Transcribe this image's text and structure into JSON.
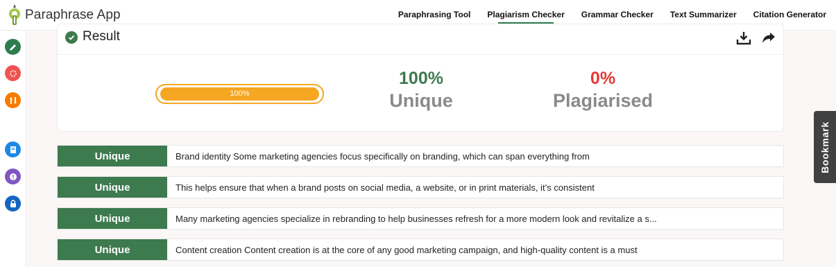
{
  "app": {
    "name": "Paraphrase App"
  },
  "nav": {
    "items": [
      {
        "label": "Paraphrasing Tool"
      },
      {
        "label": "Plagiarism Checker",
        "active": true
      },
      {
        "label": "Grammar Checker"
      },
      {
        "label": "Text Summarizer"
      },
      {
        "label": "Citation Generator"
      }
    ]
  },
  "sidebar": {
    "buttons": [
      {
        "icon": "pencil-icon",
        "color": "#2e7d4f"
      },
      {
        "icon": "spinner-icon",
        "color": "#ef5350"
      },
      {
        "icon": "sort-arrows-icon",
        "color": "#f57c00"
      },
      {
        "icon": "document-icon",
        "color": "#1e88e5"
      },
      {
        "icon": "alert-icon",
        "color": "#7e57c2"
      },
      {
        "icon": "lock-icon",
        "color": "#1565c0"
      }
    ]
  },
  "result": {
    "title": "Result",
    "progress_label": "100%",
    "progress_value": 100,
    "unique_pct": "100%",
    "unique_label": "Unique",
    "plag_pct": "0%",
    "plag_label": "Plagiarised"
  },
  "rows": [
    {
      "badge": "Unique",
      "text": "Brand identity Some marketing agencies focus specifically on branding, which can span everything from"
    },
    {
      "badge": "Unique",
      "text": "This helps ensure that when a brand posts on social media, a website, or in print materials, it’s consistent"
    },
    {
      "badge": "Unique",
      "text": "Many marketing agencies specialize in rebranding to help businesses refresh for a more modern look and revitalize a s..."
    },
    {
      "badge": "Unique",
      "text": "Content creation Content creation is at the core of any good marketing campaign, and high-quality content is a must"
    }
  ],
  "bookmark": {
    "label": "Bookmark"
  },
  "colors": {
    "accent": "#3d7a4e",
    "progress": "#f5a623",
    "danger": "#e53935"
  }
}
